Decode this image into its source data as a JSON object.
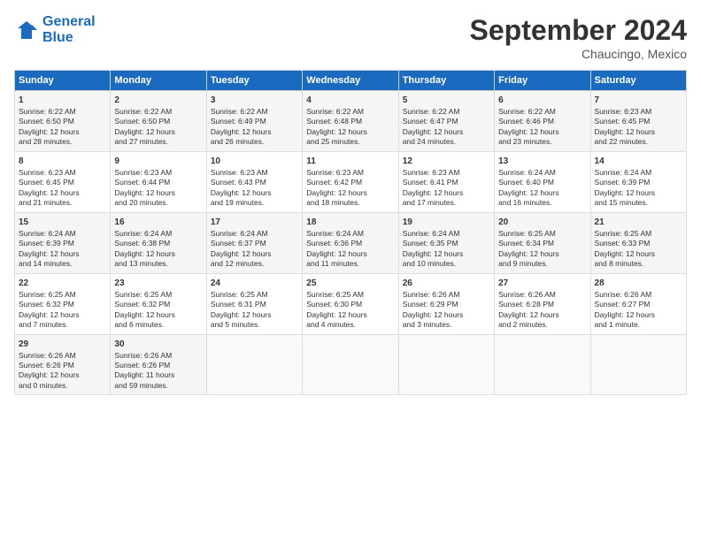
{
  "logo": {
    "line1": "General",
    "line2": "Blue"
  },
  "title": "September 2024",
  "subtitle": "Chaucingo, Mexico",
  "days_header": [
    "Sunday",
    "Monday",
    "Tuesday",
    "Wednesday",
    "Thursday",
    "Friday",
    "Saturday"
  ],
  "rows": [
    [
      {
        "day": "1",
        "lines": [
          "Sunrise: 6:22 AM",
          "Sunset: 6:50 PM",
          "Daylight: 12 hours",
          "and 28 minutes."
        ]
      },
      {
        "day": "2",
        "lines": [
          "Sunrise: 6:22 AM",
          "Sunset: 6:50 PM",
          "Daylight: 12 hours",
          "and 27 minutes."
        ]
      },
      {
        "day": "3",
        "lines": [
          "Sunrise: 6:22 AM",
          "Sunset: 6:49 PM",
          "Daylight: 12 hours",
          "and 26 minutes."
        ]
      },
      {
        "day": "4",
        "lines": [
          "Sunrise: 6:22 AM",
          "Sunset: 6:48 PM",
          "Daylight: 12 hours",
          "and 25 minutes."
        ]
      },
      {
        "day": "5",
        "lines": [
          "Sunrise: 6:22 AM",
          "Sunset: 6:47 PM",
          "Daylight: 12 hours",
          "and 24 minutes."
        ]
      },
      {
        "day": "6",
        "lines": [
          "Sunrise: 6:22 AM",
          "Sunset: 6:46 PM",
          "Daylight: 12 hours",
          "and 23 minutes."
        ]
      },
      {
        "day": "7",
        "lines": [
          "Sunrise: 6:23 AM",
          "Sunset: 6:45 PM",
          "Daylight: 12 hours",
          "and 22 minutes."
        ]
      }
    ],
    [
      {
        "day": "8",
        "lines": [
          "Sunrise: 6:23 AM",
          "Sunset: 6:45 PM",
          "Daylight: 12 hours",
          "and 21 minutes."
        ]
      },
      {
        "day": "9",
        "lines": [
          "Sunrise: 6:23 AM",
          "Sunset: 6:44 PM",
          "Daylight: 12 hours",
          "and 20 minutes."
        ]
      },
      {
        "day": "10",
        "lines": [
          "Sunrise: 6:23 AM",
          "Sunset: 6:43 PM",
          "Daylight: 12 hours",
          "and 19 minutes."
        ]
      },
      {
        "day": "11",
        "lines": [
          "Sunrise: 6:23 AM",
          "Sunset: 6:42 PM",
          "Daylight: 12 hours",
          "and 18 minutes."
        ]
      },
      {
        "day": "12",
        "lines": [
          "Sunrise: 6:23 AM",
          "Sunset: 6:41 PM",
          "Daylight: 12 hours",
          "and 17 minutes."
        ]
      },
      {
        "day": "13",
        "lines": [
          "Sunrise: 6:24 AM",
          "Sunset: 6:40 PM",
          "Daylight: 12 hours",
          "and 16 minutes."
        ]
      },
      {
        "day": "14",
        "lines": [
          "Sunrise: 6:24 AM",
          "Sunset: 6:39 PM",
          "Daylight: 12 hours",
          "and 15 minutes."
        ]
      }
    ],
    [
      {
        "day": "15",
        "lines": [
          "Sunrise: 6:24 AM",
          "Sunset: 6:39 PM",
          "Daylight: 12 hours",
          "and 14 minutes."
        ]
      },
      {
        "day": "16",
        "lines": [
          "Sunrise: 6:24 AM",
          "Sunset: 6:38 PM",
          "Daylight: 12 hours",
          "and 13 minutes."
        ]
      },
      {
        "day": "17",
        "lines": [
          "Sunrise: 6:24 AM",
          "Sunset: 6:37 PM",
          "Daylight: 12 hours",
          "and 12 minutes."
        ]
      },
      {
        "day": "18",
        "lines": [
          "Sunrise: 6:24 AM",
          "Sunset: 6:36 PM",
          "Daylight: 12 hours",
          "and 11 minutes."
        ]
      },
      {
        "day": "19",
        "lines": [
          "Sunrise: 6:24 AM",
          "Sunset: 6:35 PM",
          "Daylight: 12 hours",
          "and 10 minutes."
        ]
      },
      {
        "day": "20",
        "lines": [
          "Sunrise: 6:25 AM",
          "Sunset: 6:34 PM",
          "Daylight: 12 hours",
          "and 9 minutes."
        ]
      },
      {
        "day": "21",
        "lines": [
          "Sunrise: 6:25 AM",
          "Sunset: 6:33 PM",
          "Daylight: 12 hours",
          "and 8 minutes."
        ]
      }
    ],
    [
      {
        "day": "22",
        "lines": [
          "Sunrise: 6:25 AM",
          "Sunset: 6:32 PM",
          "Daylight: 12 hours",
          "and 7 minutes."
        ]
      },
      {
        "day": "23",
        "lines": [
          "Sunrise: 6:25 AM",
          "Sunset: 6:32 PM",
          "Daylight: 12 hours",
          "and 6 minutes."
        ]
      },
      {
        "day": "24",
        "lines": [
          "Sunrise: 6:25 AM",
          "Sunset: 6:31 PM",
          "Daylight: 12 hours",
          "and 5 minutes."
        ]
      },
      {
        "day": "25",
        "lines": [
          "Sunrise: 6:25 AM",
          "Sunset: 6:30 PM",
          "Daylight: 12 hours",
          "and 4 minutes."
        ]
      },
      {
        "day": "26",
        "lines": [
          "Sunrise: 6:26 AM",
          "Sunset: 6:29 PM",
          "Daylight: 12 hours",
          "and 3 minutes."
        ]
      },
      {
        "day": "27",
        "lines": [
          "Sunrise: 6:26 AM",
          "Sunset: 6:28 PM",
          "Daylight: 12 hours",
          "and 2 minutes."
        ]
      },
      {
        "day": "28",
        "lines": [
          "Sunrise: 6:26 AM",
          "Sunset: 6:27 PM",
          "Daylight: 12 hours",
          "and 1 minute."
        ]
      }
    ],
    [
      {
        "day": "29",
        "lines": [
          "Sunrise: 6:26 AM",
          "Sunset: 6:26 PM",
          "Daylight: 12 hours",
          "and 0 minutes."
        ]
      },
      {
        "day": "30",
        "lines": [
          "Sunrise: 6:26 AM",
          "Sunset: 6:26 PM",
          "Daylight: 11 hours",
          "and 59 minutes."
        ]
      },
      {
        "day": "",
        "lines": []
      },
      {
        "day": "",
        "lines": []
      },
      {
        "day": "",
        "lines": []
      },
      {
        "day": "",
        "lines": []
      },
      {
        "day": "",
        "lines": []
      }
    ]
  ]
}
